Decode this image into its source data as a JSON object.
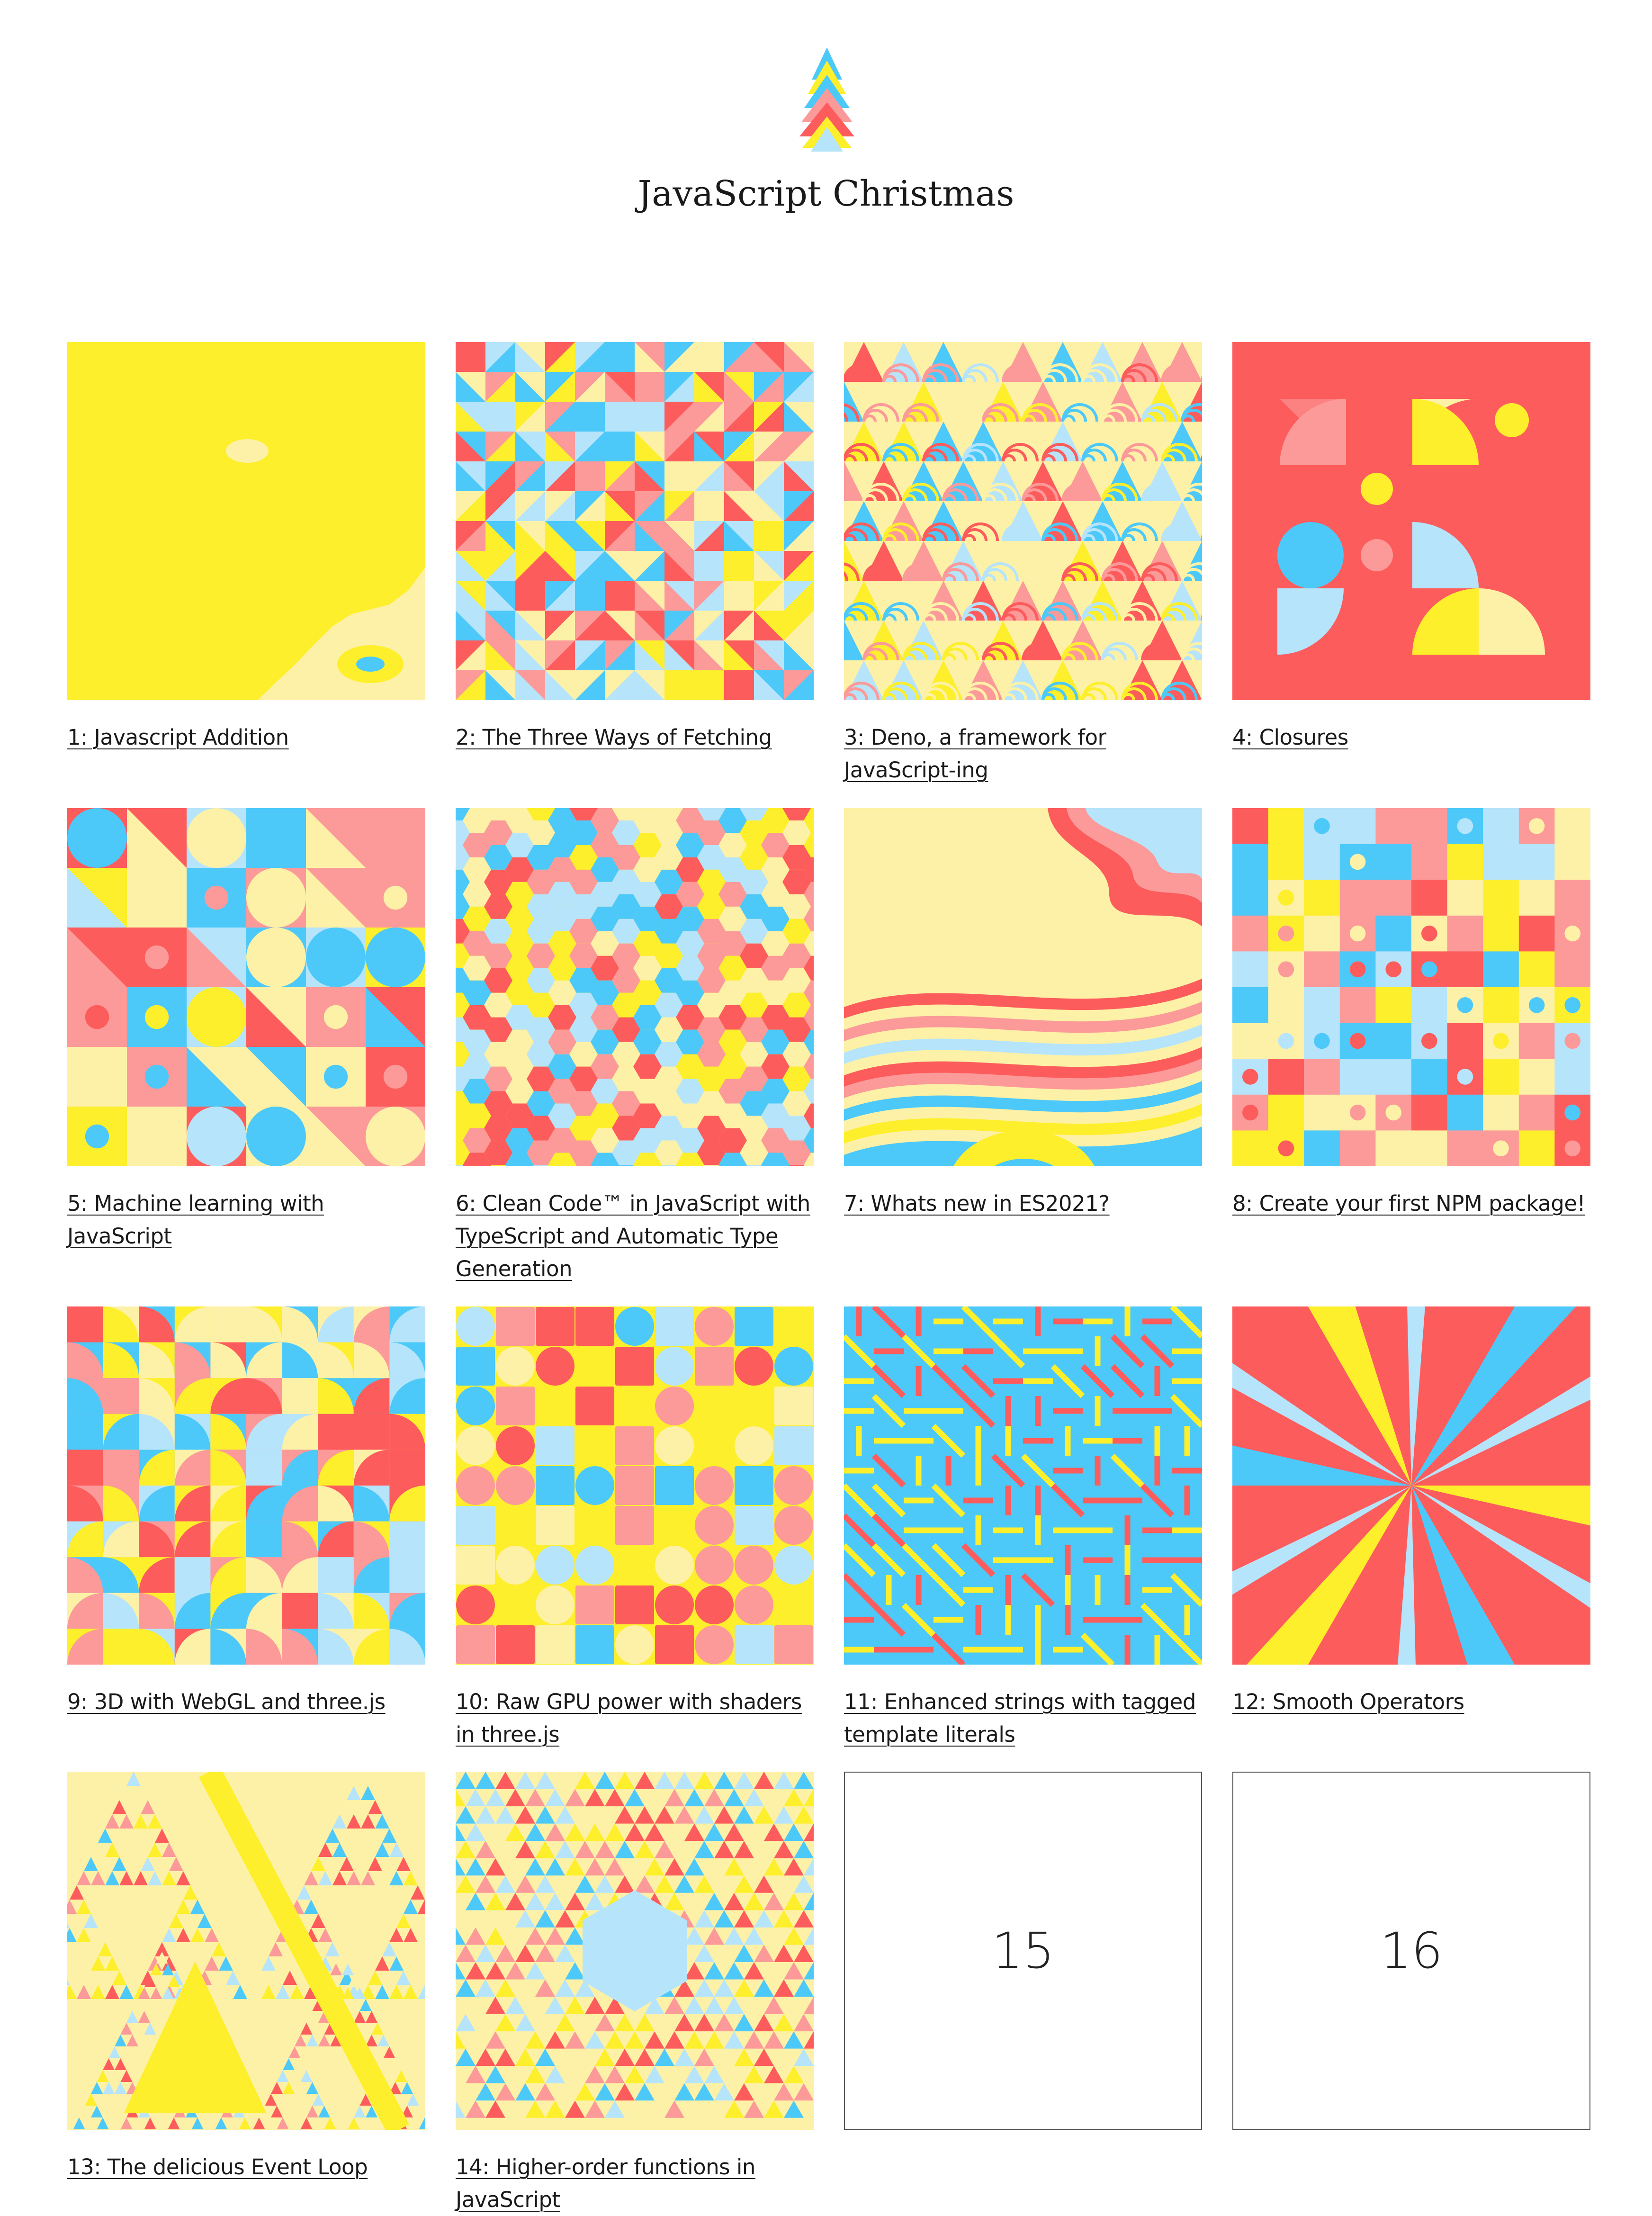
{
  "site": {
    "title": "JavaScript Christmas"
  },
  "colors": {
    "red": "#fd5c5c",
    "pink": "#fc9999",
    "yellow": "#fdef2b",
    "cream": "#fdf1a7",
    "blue": "#4cc9f9",
    "lightblue": "#b6e4fb"
  },
  "cards": [
    {
      "number": 1,
      "title": "1: Javascript Addition",
      "art": "topo"
    },
    {
      "number": 2,
      "title": "2: The Three Ways of Fetching",
      "art": "triangles"
    },
    {
      "number": 3,
      "title": "3: Deno, a framework for JavaScript-ing",
      "art": "arcs"
    },
    {
      "number": 4,
      "title": "4: Closures",
      "art": "closures"
    },
    {
      "number": 5,
      "title": "5: Machine learning with JavaScript",
      "art": "shapes"
    },
    {
      "number": 6,
      "title": "6: Clean Code™ in JavaScript with TypeScript and Automatic Type Generation",
      "art": "hexes"
    },
    {
      "number": 7,
      "title": "7: Whats new in ES2021?",
      "art": "waves"
    },
    {
      "number": 8,
      "title": "8: Create your first NPM package!",
      "art": "dots"
    },
    {
      "number": 9,
      "title": "9: 3D with WebGL and three.js",
      "art": "truchet"
    },
    {
      "number": 10,
      "title": "10: Raw GPU power with shaders in three.js",
      "art": "blobs"
    },
    {
      "number": 11,
      "title": "11: Enhanced strings with tagged template literals",
      "art": "maze"
    },
    {
      "number": 12,
      "title": "12: Smooth Operators",
      "art": "star"
    },
    {
      "number": 13,
      "title": "13: The delicious Event Loop",
      "art": "sierpinski"
    },
    {
      "number": 14,
      "title": "14: Higher-order functions in JavaScript",
      "art": "kaleido"
    },
    {
      "number": 15,
      "placeholder": "15"
    },
    {
      "number": 16,
      "placeholder": "16"
    }
  ]
}
